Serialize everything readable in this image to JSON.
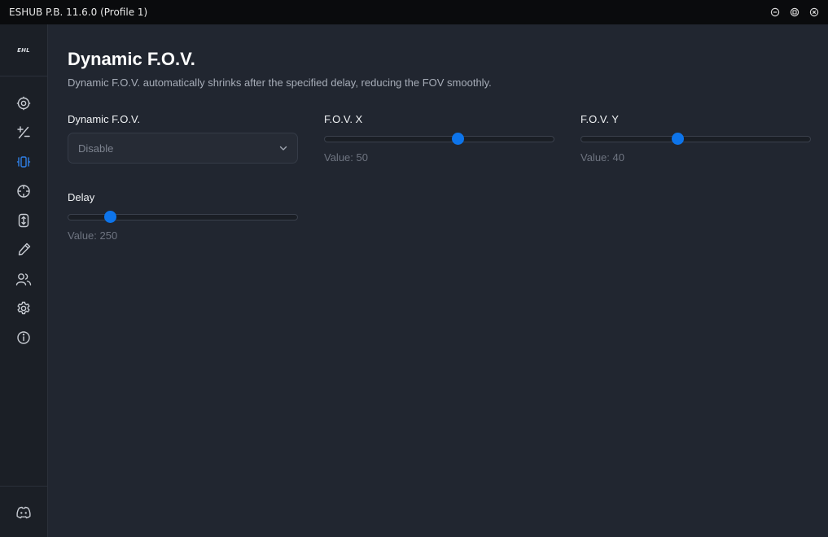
{
  "window": {
    "title": "ESHUB P.B. 11.6.0 (Profile 1)"
  },
  "sidebar": {
    "logo_text": "EHL",
    "items": [
      {
        "icon": "target-icon",
        "active": false
      },
      {
        "icon": "plus-minus-icon",
        "active": false
      },
      {
        "icon": "dynamic-fov-icon",
        "active": true
      },
      {
        "icon": "crosshair-icon",
        "active": false
      },
      {
        "icon": "scroll-icon",
        "active": false
      },
      {
        "icon": "pipette-icon",
        "active": false
      },
      {
        "icon": "users-icon",
        "active": false
      },
      {
        "icon": "gear-icon",
        "active": false
      },
      {
        "icon": "info-icon",
        "active": false
      }
    ],
    "bottom_icon": "discord-icon"
  },
  "main": {
    "title": "Dynamic F.O.V.",
    "description": "Dynamic F.O.V. automatically shrinks after the specified delay, reducing the FOV smoothly.",
    "dynamic_fov": {
      "label": "Dynamic F.O.V.",
      "selected": "Disable"
    },
    "fov_x": {
      "label": "F.O.V. X",
      "value": 50,
      "fraction": 0.58,
      "value_text": "Value: 50"
    },
    "fov_y": {
      "label": "F.O.V. Y",
      "value": 40,
      "fraction": 0.42,
      "value_text": "Value: 40"
    },
    "delay": {
      "label": "Delay",
      "value": 250,
      "fraction": 0.185,
      "value_text": "Value: 250"
    }
  },
  "colors": {
    "accent": "#0d74ea",
    "active_icon": "#2f7fe6",
    "icon": "#c8ccd3",
    "background": "#212630",
    "sidebar": "#1b1f26",
    "titlebar": "#0a0b0d"
  }
}
